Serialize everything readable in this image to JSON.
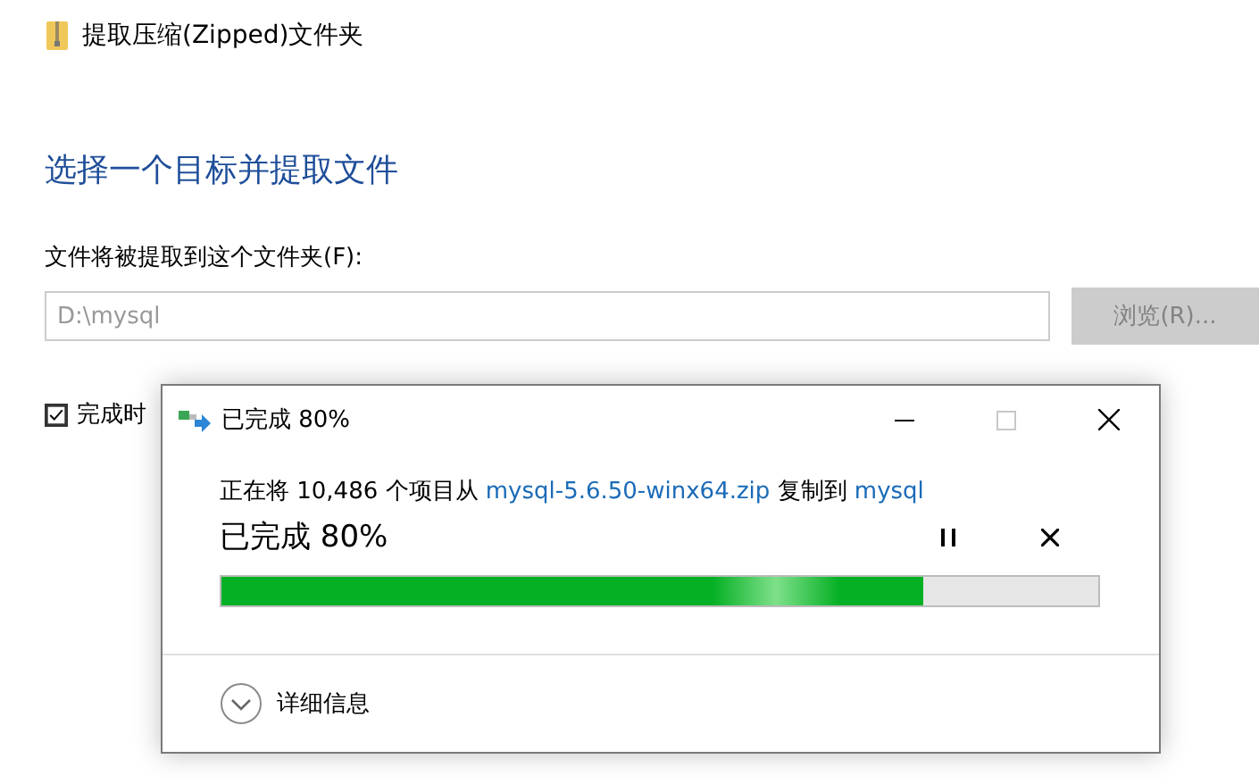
{
  "window": {
    "title": "提取压缩(Zipped)文件夹"
  },
  "heading": "选择一个目标并提取文件",
  "destination": {
    "label": "文件将被提取到这个文件夹(F):",
    "value": "D:\\mysql",
    "disabled": true
  },
  "browse_button": {
    "label": "浏览(R)...",
    "disabled": true
  },
  "show_when_done": {
    "label": "完成时",
    "checked": true
  },
  "progress_dialog": {
    "title": "已完成 80%",
    "message": [
      {
        "text": "正在将 10,486 个项目从 ",
        "link": false
      },
      {
        "text": "mysql-5.6.50-winx64.zip",
        "link": true
      },
      {
        "text": " 复制到 ",
        "link": false
      },
      {
        "text": "mysql",
        "link": true
      }
    ],
    "status": "已完成 80%",
    "level": 0.8,
    "details": "详细信息"
  }
}
